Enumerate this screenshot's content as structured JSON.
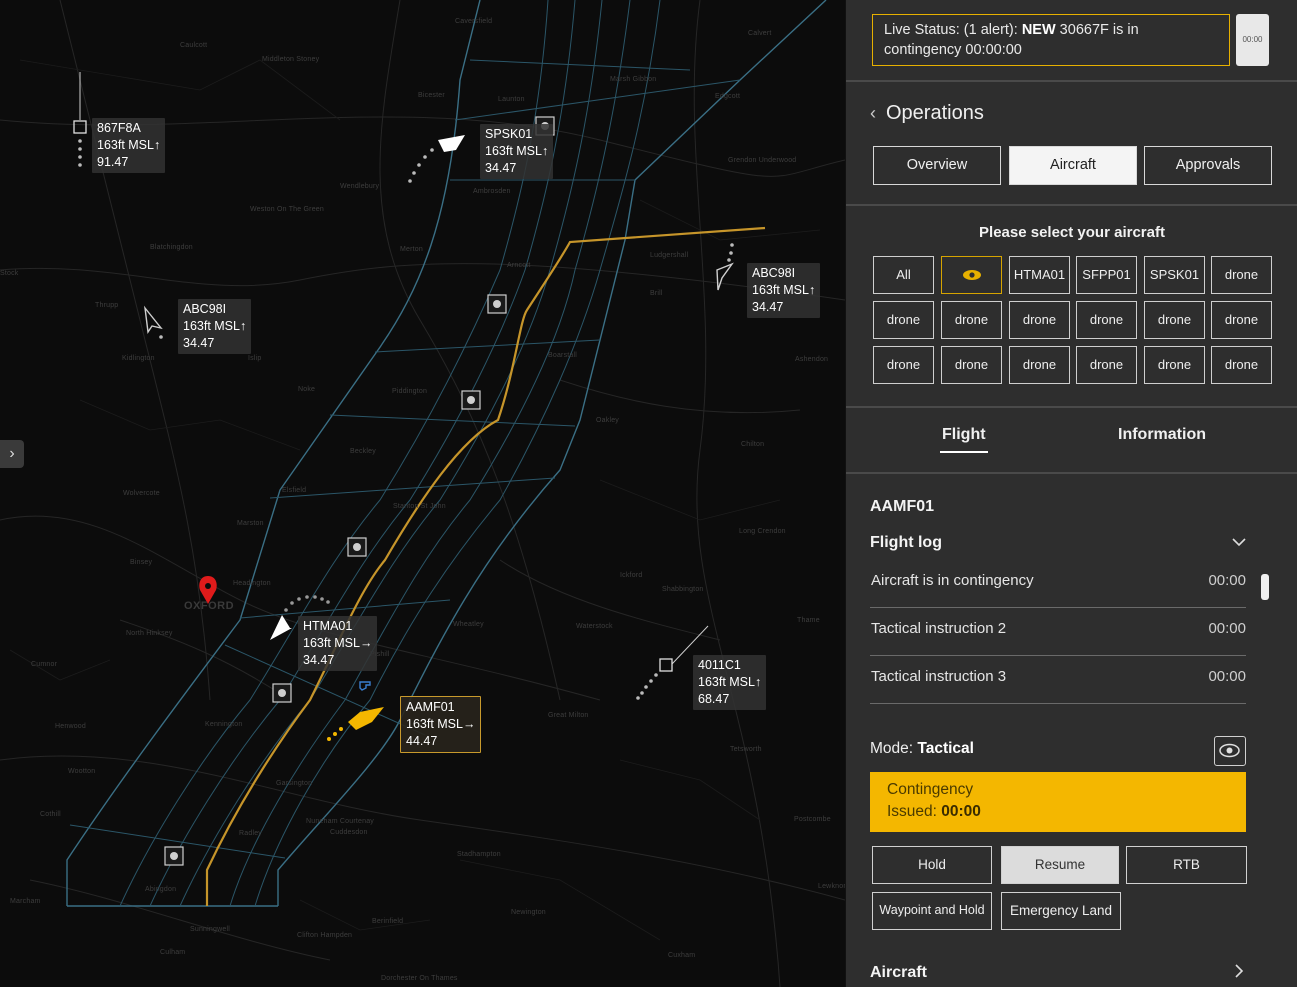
{
  "status": {
    "prefix": "Live Status: (1 alert): ",
    "highlight": "NEW",
    "suffix": " 30667F is in contingency 00:00:00",
    "timer_label": "00:00"
  },
  "operations": {
    "title": "Operations",
    "tabs": [
      "Overview",
      "Aircraft",
      "Approvals"
    ],
    "active_tab": "Aircraft"
  },
  "aircraft_select": {
    "title": "Please select your aircraft",
    "buttons": [
      "All",
      "",
      "HTMA01",
      "SFPP01",
      "SPSK01",
      "drone",
      "drone",
      "drone",
      "drone",
      "drone",
      "drone",
      "drone",
      "drone",
      "drone",
      "drone",
      "drone",
      "drone",
      "drone"
    ]
  },
  "subtabs": [
    "Flight",
    "Information"
  ],
  "flight": {
    "id": "AAMF01",
    "log_title": "Flight log",
    "log": [
      {
        "text": "Aircraft is in contingency",
        "time": "00:00"
      },
      {
        "text": "Tactical instruction 2",
        "time": "00:00"
      },
      {
        "text": "Tactical instruction 3",
        "time": "00:00"
      }
    ],
    "mode_label": "Mode: ",
    "mode_value": "Tactical",
    "alert_title": "Contingency",
    "alert_issued_label": "Issued: ",
    "alert_issued_value": "00:00",
    "actions": [
      "Hold",
      "Resume",
      "RTB",
      "Waypoint and Hold",
      "Emergency Land"
    ],
    "aircraft_section": "Aircraft"
  },
  "map": {
    "city": "OXFORD",
    "labels": [
      {
        "id": "867F8A",
        "alt": "163ft MSL",
        "arrow": "↑",
        "val": "91.47"
      },
      {
        "id": "SPSK01",
        "alt": "163ft MSL",
        "arrow": "↑",
        "val": "34.47"
      },
      {
        "id": "ABC98I",
        "alt": "163ft MSL",
        "arrow": "↑",
        "val": "34.47"
      },
      {
        "id": "ABC98I",
        "alt": "163ft MSL",
        "arrow": "↑",
        "val": "34.47"
      },
      {
        "id": "HTMA01",
        "alt": "163ft MSL",
        "arrow": "→",
        "val": "34.47"
      },
      {
        "id": "AAMF01",
        "alt": "163ft MSL",
        "arrow": "→",
        "val": "44.47"
      },
      {
        "id": "4011C1",
        "alt": "163ft MSL",
        "arrow": "↑",
        "val": "68.47"
      }
    ],
    "towns": [
      "Caversfield",
      "Caulcott",
      "Middleton Stoney",
      "Bicester",
      "Launton",
      "Marsh Gibbon",
      "Edgcott",
      "Calvert",
      "Wendlebury",
      "Ambrosden",
      "Weston On The Green",
      "Blatchingdon",
      "Merton",
      "Arncott",
      "Ludgershall",
      "Grendon Underwood",
      "Stock",
      "Thrupp",
      "Kidlington",
      "Islip",
      "Piddington",
      "Boarstall",
      "Brill",
      "Ashendon",
      "Noke",
      "Oakley",
      "Beckley",
      "Chilton",
      "Elsfield",
      "Stanton St John",
      "Long Crendon",
      "Marston",
      "Wolvercote",
      "Binsey",
      "North Hinksey",
      "Headington",
      "Wheatley",
      "Ickford",
      "Shabbington",
      "Thame",
      "Cumnor",
      "Waterstock",
      "Kennington",
      "Great Milton",
      "Henwood",
      "Tetsworth",
      "Wootton",
      "Garsington",
      "Radley",
      "Cuddesdon",
      "Nuneham Courtenay",
      "Pishill",
      "Abingdon",
      "Marcham",
      "Stadhampton",
      "Newington",
      "Culham",
      "Berinfield",
      "Clifton Hampden",
      "Dorchester On Thames",
      "Cuxham",
      "Postcombe",
      "Lewknor",
      "Sunningwell",
      "Cothill"
    ]
  }
}
